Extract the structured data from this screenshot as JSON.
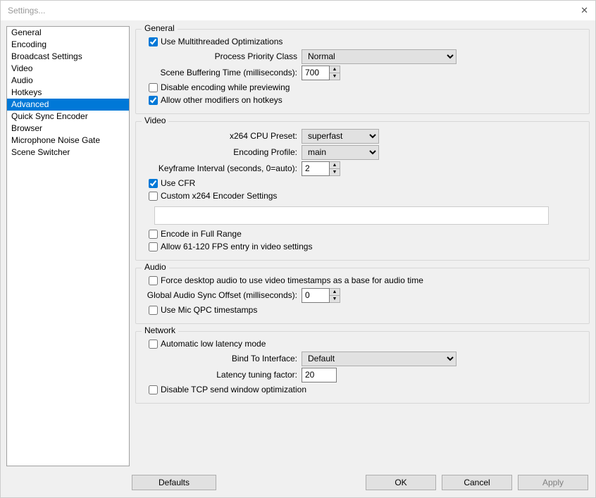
{
  "window": {
    "title": "Settings..."
  },
  "sidebar": {
    "items": [
      {
        "label": "General"
      },
      {
        "label": "Encoding"
      },
      {
        "label": "Broadcast Settings"
      },
      {
        "label": "Video"
      },
      {
        "label": "Audio"
      },
      {
        "label": "Hotkeys"
      },
      {
        "label": "Advanced"
      },
      {
        "label": "Quick Sync Encoder"
      },
      {
        "label": "Browser"
      },
      {
        "label": "Microphone Noise Gate"
      },
      {
        "label": "Scene Switcher"
      }
    ],
    "selected": "Advanced"
  },
  "general": {
    "title": "General",
    "multithreaded": "Use Multithreaded Optimizations",
    "priority_label": "Process Priority Class",
    "priority_value": "Normal",
    "buffering_label": "Scene Buffering Time (milliseconds):",
    "buffering_value": "700",
    "disable_encoding": "Disable encoding while previewing",
    "allow_modifiers": "Allow other modifiers on hotkeys"
  },
  "video": {
    "title": "Video",
    "preset_label": "x264 CPU Preset:",
    "preset_value": "superfast",
    "profile_label": "Encoding Profile:",
    "profile_value": "main",
    "keyframe_label": "Keyframe Interval (seconds, 0=auto):",
    "keyframe_value": "2",
    "cfr": "Use CFR",
    "custom": "Custom x264 Encoder Settings",
    "fullrange": "Encode in Full Range",
    "fps120": "Allow 61-120 FPS entry in video settings"
  },
  "audio": {
    "title": "Audio",
    "force_ts": "Force desktop audio to use video timestamps as a base for audio time",
    "sync_label": "Global Audio Sync Offset (milliseconds):",
    "sync_value": "0",
    "qpc": "Use Mic QPC timestamps"
  },
  "network": {
    "title": "Network",
    "auto_low_lat": "Automatic low latency mode",
    "bind_label": "Bind To Interface:",
    "bind_value": "Default",
    "latency_label": "Latency tuning factor:",
    "latency_value": "20",
    "disable_tcp": "Disable TCP send window optimization"
  },
  "footer": {
    "defaults": "Defaults",
    "ok": "OK",
    "cancel": "Cancel",
    "apply": "Apply"
  }
}
